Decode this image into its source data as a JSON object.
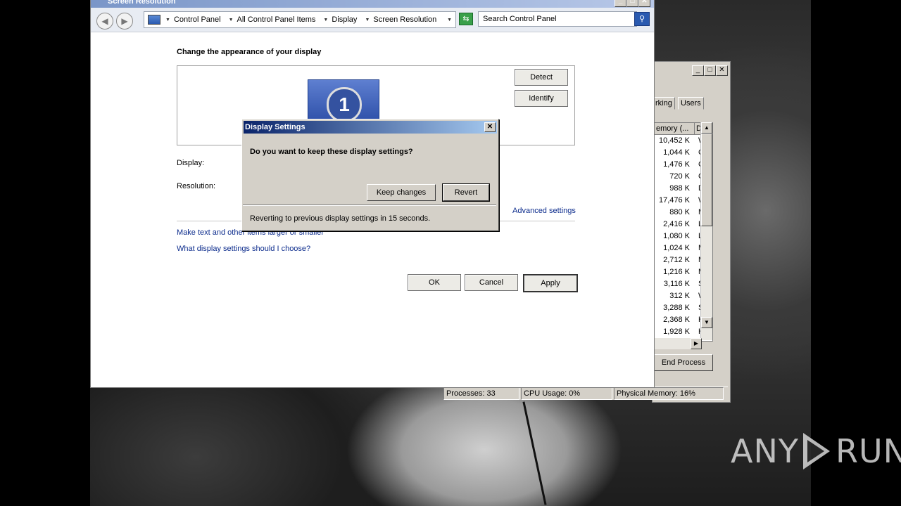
{
  "screen_resolution": {
    "title": "Screen Resolution",
    "breadcrumbs": [
      "Control Panel",
      "All Control Panel Items",
      "Display",
      "Screen Resolution"
    ],
    "search_placeholder": "Search Control Panel",
    "heading": "Change the appearance of your display",
    "monitor_number": "1",
    "detect_label": "Detect",
    "identify_label": "Identify",
    "display_label": "Display:",
    "resolution_label": "Resolution:",
    "advanced_settings": "Advanced settings",
    "link_text_size": "Make text and other items larger or smaller",
    "link_which_settings": "What display settings should I choose?",
    "ok_label": "OK",
    "cancel_label": "Cancel",
    "apply_label": "Apply"
  },
  "dialog": {
    "title": "Display Settings",
    "close_label": "✕",
    "question": "Do you want to keep these display settings?",
    "keep_label": "Keep changes",
    "revert_label": "Revert",
    "countdown": "Reverting to previous display settings in 15 seconds."
  },
  "task_manager": {
    "tabs": [
      "rking",
      "Users"
    ],
    "column_memory": "emory (...",
    "column_d": "D",
    "rows": [
      {
        "mem": "10,452 K",
        "d": "W"
      },
      {
        "mem": "1,044 K",
        "d": "C"
      },
      {
        "mem": "1,476 K",
        "d": "C"
      },
      {
        "mem": "720 K",
        "d": "C"
      },
      {
        "mem": "988 K",
        "d": "D"
      },
      {
        "mem": "17,476 K",
        "d": "W"
      },
      {
        "mem": "880 K",
        "d": "M"
      },
      {
        "mem": "2,416 K",
        "d": "Lo"
      },
      {
        "mem": "1,080 K",
        "d": "Lo"
      },
      {
        "mem": "1,024 K",
        "d": "M"
      },
      {
        "mem": "2,712 K",
        "d": "M"
      },
      {
        "mem": "1,216 K",
        "d": "M"
      },
      {
        "mem": "3,116 K",
        "d": "Se"
      },
      {
        "mem": "312 K",
        "d": "W"
      },
      {
        "mem": "3,288 K",
        "d": "Sp"
      },
      {
        "mem": "2,368 K",
        "d": "H"
      },
      {
        "mem": "1,928 K",
        "d": "H"
      }
    ],
    "end_process_label": "End Process",
    "status": {
      "processes": "Processes: 33",
      "cpu": "CPU Usage: 0%",
      "memory": "Physical Memory: 16%"
    }
  },
  "watermark": "ANY RUN"
}
